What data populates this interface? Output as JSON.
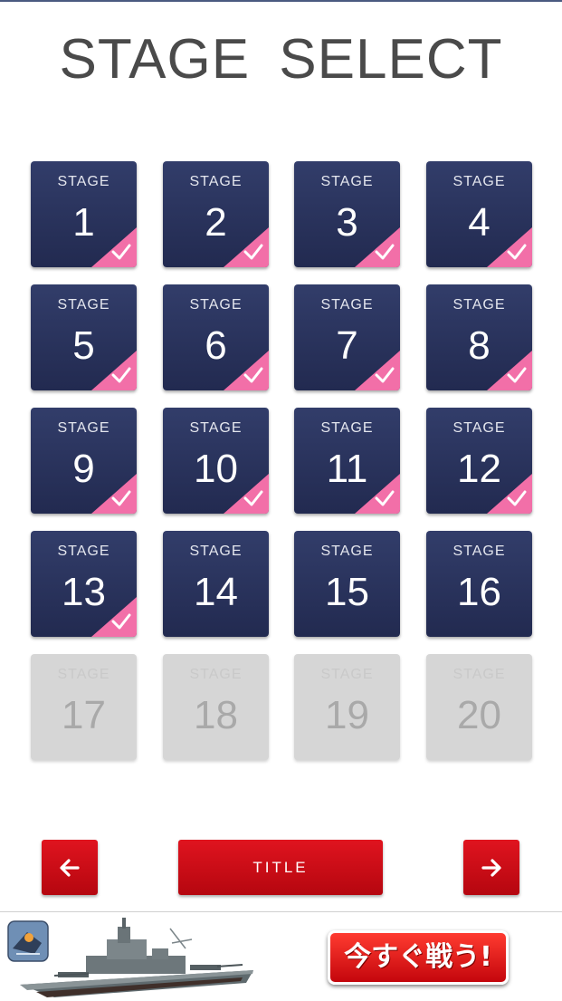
{
  "header": {
    "title": "STAGE  SELECT"
  },
  "stage_grid": {
    "stage_label": "STAGE",
    "stages": [
      {
        "number": "1",
        "status": "cleared"
      },
      {
        "number": "2",
        "status": "cleared"
      },
      {
        "number": "3",
        "status": "cleared"
      },
      {
        "number": "4",
        "status": "cleared"
      },
      {
        "number": "5",
        "status": "cleared"
      },
      {
        "number": "6",
        "status": "cleared"
      },
      {
        "number": "7",
        "status": "cleared"
      },
      {
        "number": "8",
        "status": "cleared"
      },
      {
        "number": "9",
        "status": "cleared"
      },
      {
        "number": "10",
        "status": "cleared"
      },
      {
        "number": "11",
        "status": "cleared"
      },
      {
        "number": "12",
        "status": "cleared"
      },
      {
        "number": "13",
        "status": "cleared"
      },
      {
        "number": "14",
        "status": "unlocked"
      },
      {
        "number": "15",
        "status": "unlocked"
      },
      {
        "number": "16",
        "status": "unlocked"
      },
      {
        "number": "17",
        "status": "locked"
      },
      {
        "number": "18",
        "status": "locked"
      },
      {
        "number": "19",
        "status": "locked"
      },
      {
        "number": "20",
        "status": "locked"
      }
    ]
  },
  "navigation": {
    "prev_icon": "arrow-left-icon",
    "title_button_label": "TITLE",
    "next_icon": "arrow-right-icon"
  },
  "ad_banner": {
    "cta_label": "今すぐ戦う!",
    "app_icon": "game-app-icon",
    "image": "battleship-image"
  },
  "colors": {
    "tile_unlocked": "#2a3460",
    "tile_locked": "#d6d6d6",
    "clear_mark": "#f26fa8",
    "nav_button": "#d10f18",
    "title_text": "#4a4a4a"
  }
}
